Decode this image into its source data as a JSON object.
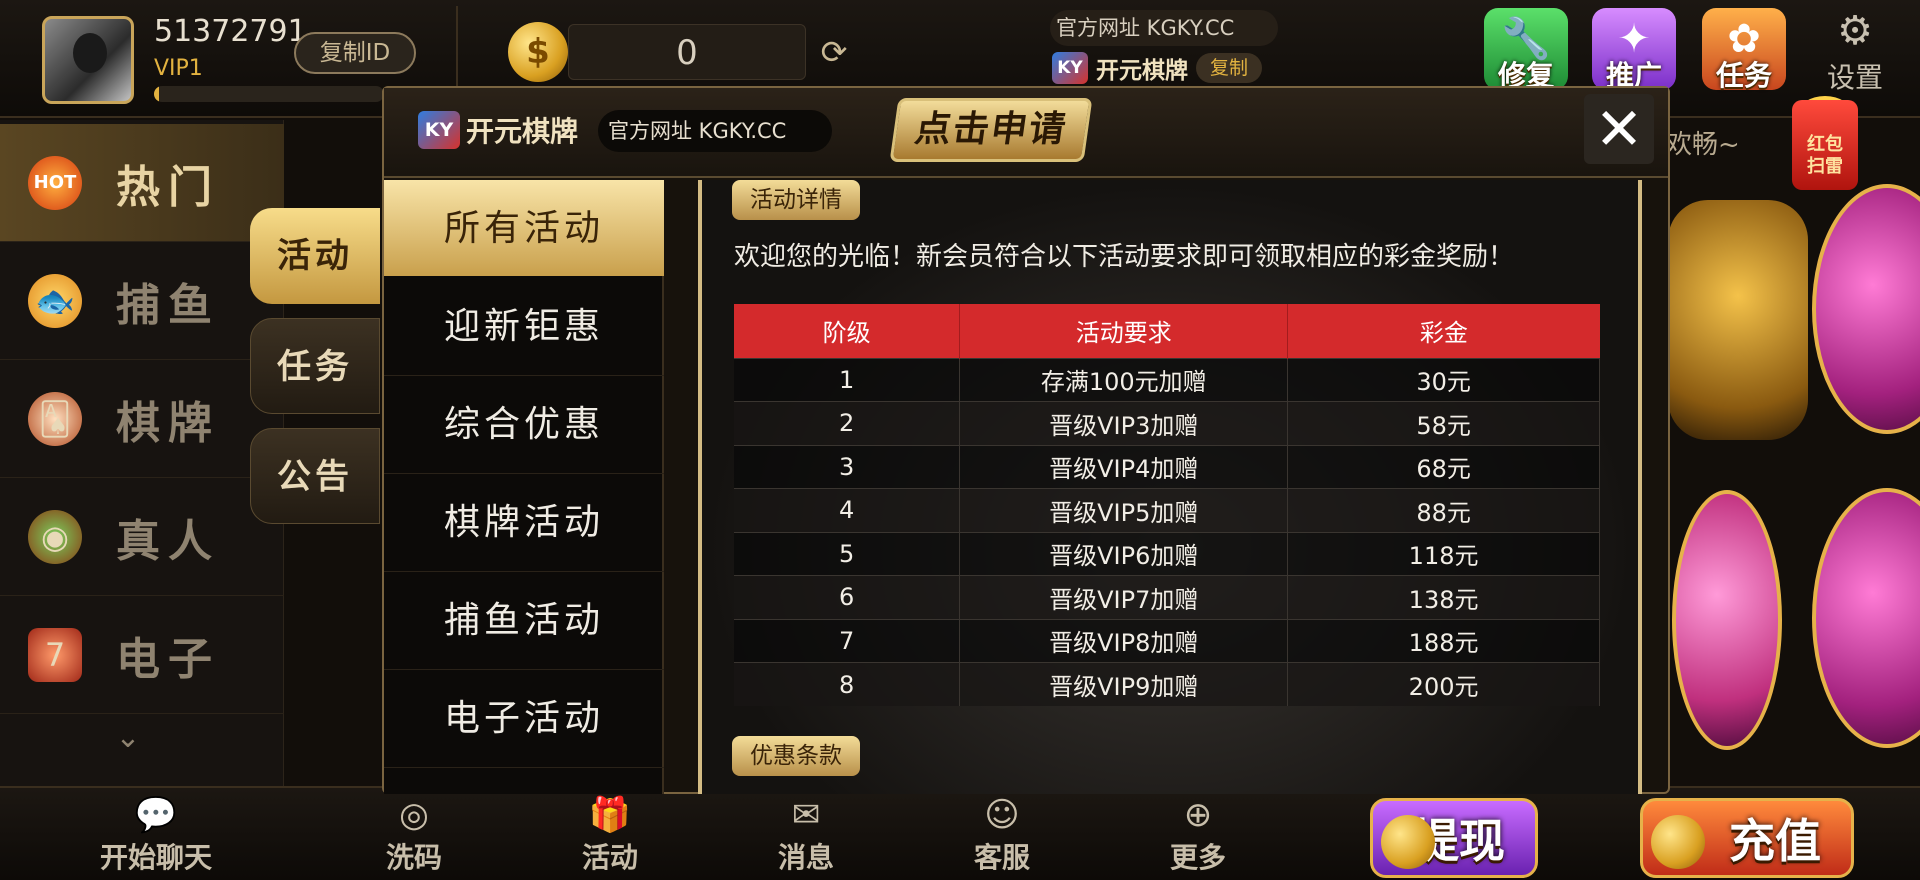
{
  "header": {
    "user_id": "51372791",
    "vip_level": "VIP1",
    "vip_progress": 0.02,
    "copy_id_label": "复制ID",
    "balance": "0",
    "site_url_text": "官方网址 KGKY.CC",
    "brand_logo": "KY",
    "brand_name": "开元棋牌",
    "copy_label": "复制",
    "actions": [
      {
        "label": "修复",
        "icon": "wrench-icon"
      },
      {
        "label": "推广",
        "icon": "promote-icon"
      },
      {
        "label": "任务",
        "icon": "task-icon"
      },
      {
        "label": "设置",
        "icon": "gear-icon"
      }
    ]
  },
  "left_nav": {
    "items": [
      {
        "label": "热门",
        "icon": "hot-icon",
        "badge": "HOT"
      },
      {
        "label": "捕鱼",
        "icon": "fish-icon"
      },
      {
        "label": "棋牌",
        "icon": "cards-icon"
      },
      {
        "label": "真人",
        "icon": "live-icon"
      },
      {
        "label": "电子",
        "icon": "slot-icon"
      }
    ],
    "active_index": 0
  },
  "side_tabs": [
    {
      "label": "活动",
      "active": true
    },
    {
      "label": "任务",
      "active": false
    },
    {
      "label": "公告",
      "active": false
    }
  ],
  "background": {
    "marquee": "欢畅~",
    "red_envelope": "红包\n扫雷"
  },
  "modal": {
    "brand_logo": "KY",
    "brand_name": "开元棋牌",
    "site_url_text": "官方网址 KGKY.CC",
    "apply_button": "点击申请",
    "close_icon": "close-icon",
    "categories": [
      "所有活动",
      "迎新钜惠",
      "综合优惠",
      "棋牌活动",
      "捕鱼活动",
      "电子活动"
    ],
    "active_category": 0,
    "details_tag": "活动详情",
    "intro": "欢迎您的光临！新会员符合以下活动要求即可领取相应的彩金奖励！",
    "table": {
      "headers": [
        "阶级",
        "活动要求",
        "彩金"
      ],
      "rows": [
        [
          "1",
          "存满100元加赠",
          "30元"
        ],
        [
          "2",
          "晋级VIP3加赠",
          "58元"
        ],
        [
          "3",
          "晋级VIP4加赠",
          "68元"
        ],
        [
          "4",
          "晋级VIP5加赠",
          "88元"
        ],
        [
          "5",
          "晋级VIP6加赠",
          "118元"
        ],
        [
          "6",
          "晋级VIP7加赠",
          "138元"
        ],
        [
          "7",
          "晋级VIP8加赠",
          "188元"
        ],
        [
          "8",
          "晋级VIP9加赠",
          "200元"
        ]
      ]
    },
    "terms_tag": "优惠条款"
  },
  "bottom_bar": {
    "items": [
      {
        "label": "开始聊天",
        "icon": "chat-icon"
      },
      {
        "label": "洗码",
        "icon": "chip-icon"
      },
      {
        "label": "活动",
        "icon": "gift-icon"
      },
      {
        "label": "消息",
        "icon": "mail-icon"
      },
      {
        "label": "客服",
        "icon": "support-icon"
      },
      {
        "label": "更多",
        "icon": "plus-icon"
      }
    ],
    "withdraw_label": "提现",
    "recharge_label": "充值"
  },
  "colors": {
    "gold": "#e3b340",
    "table_header_red": "#d42a2c",
    "background": "#120e0a"
  }
}
